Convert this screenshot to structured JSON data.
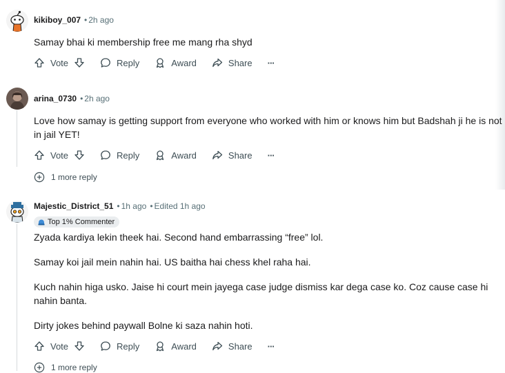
{
  "comments": [
    {
      "username": "kikiboy_007",
      "time": "2h ago",
      "paragraphs": [
        "Samay bhai ki membership free me mang rha shyd"
      ],
      "actions": {
        "vote": "Vote",
        "reply": "Reply",
        "award": "Award",
        "share": "Share",
        "more": "···"
      }
    },
    {
      "username": "arina_0730",
      "time": "2h ago",
      "paragraphs": [
        "Love how samay is getting support from everyone who worked with him or knows him but Badshah ji he is not in jail YET!"
      ],
      "actions": {
        "vote": "Vote",
        "reply": "Reply",
        "award": "Award",
        "share": "Share",
        "more": "···"
      },
      "more_replies": "1 more reply"
    },
    {
      "username": "Majestic_District_51",
      "time": "1h ago",
      "edited": "Edited 1h ago",
      "badge": "Top 1% Commenter",
      "paragraphs": [
        "Zyada kardiya lekin theek hai. Second hand embarrassing “free” lol.",
        "Samay koi jail mein nahin hai. US baitha hai chess khel raha hai.",
        "Kuch nahin higa usko. Jaise hi court mein jayega case judge dismiss kar dega case ko. Coz cause case hi nahin banta.",
        "Dirty jokes behind paywall Bolne ki saza nahin hoti."
      ],
      "actions": {
        "vote": "Vote",
        "reply": "Reply",
        "award": "Award",
        "share": "Share",
        "more": "···"
      },
      "more_replies": "1 more reply"
    }
  ],
  "colors": {
    "text": "#1a1a1b",
    "meta": "#576f76",
    "action": "#3d4d54",
    "badge_bg": "#eaedef",
    "thread": "#d6dadc"
  }
}
